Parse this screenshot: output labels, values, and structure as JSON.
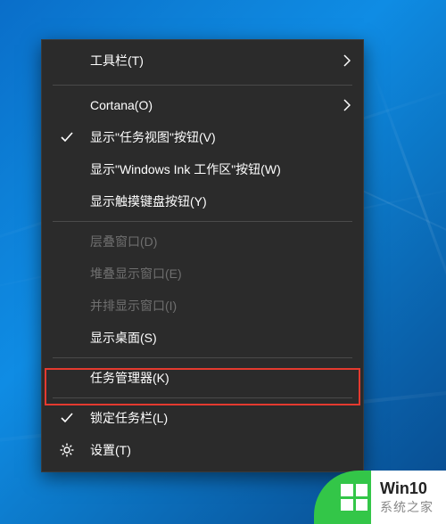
{
  "menu": {
    "items": [
      {
        "label": "工具栏(T)",
        "hasSubmenu": true,
        "disabled": false,
        "icon": null
      },
      {
        "label": "Cortana(O)",
        "hasSubmenu": true,
        "disabled": false,
        "icon": null
      },
      {
        "label": "显示\"任务视图\"按钮(V)",
        "hasSubmenu": false,
        "disabled": false,
        "icon": "check"
      },
      {
        "label": "显示\"Windows Ink 工作区\"按钮(W)",
        "hasSubmenu": false,
        "disabled": false,
        "icon": null
      },
      {
        "label": "显示触摸键盘按钮(Y)",
        "hasSubmenu": false,
        "disabled": false,
        "icon": null
      },
      {
        "label": "层叠窗口(D)",
        "hasSubmenu": false,
        "disabled": true,
        "icon": null
      },
      {
        "label": "堆叠显示窗口(E)",
        "hasSubmenu": false,
        "disabled": true,
        "icon": null
      },
      {
        "label": "并排显示窗口(I)",
        "hasSubmenu": false,
        "disabled": true,
        "icon": null
      },
      {
        "label": "显示桌面(S)",
        "hasSubmenu": false,
        "disabled": false,
        "icon": null
      },
      {
        "label": "任务管理器(K)",
        "hasSubmenu": false,
        "disabled": false,
        "icon": null,
        "highlighted": true
      },
      {
        "label": "锁定任务栏(L)",
        "hasSubmenu": false,
        "disabled": false,
        "icon": "check"
      },
      {
        "label": "设置(T)",
        "hasSubmenu": false,
        "disabled": false,
        "icon": "gear"
      }
    ]
  },
  "brand": {
    "title": "Win10",
    "subtitle": "系统之家"
  },
  "colors": {
    "menuBg": "#2b2b2b",
    "menuText": "#ffffff",
    "menuDisabled": "#6f6f6f",
    "highlight": "#e43a2f",
    "brandGreen": "#33c648"
  }
}
